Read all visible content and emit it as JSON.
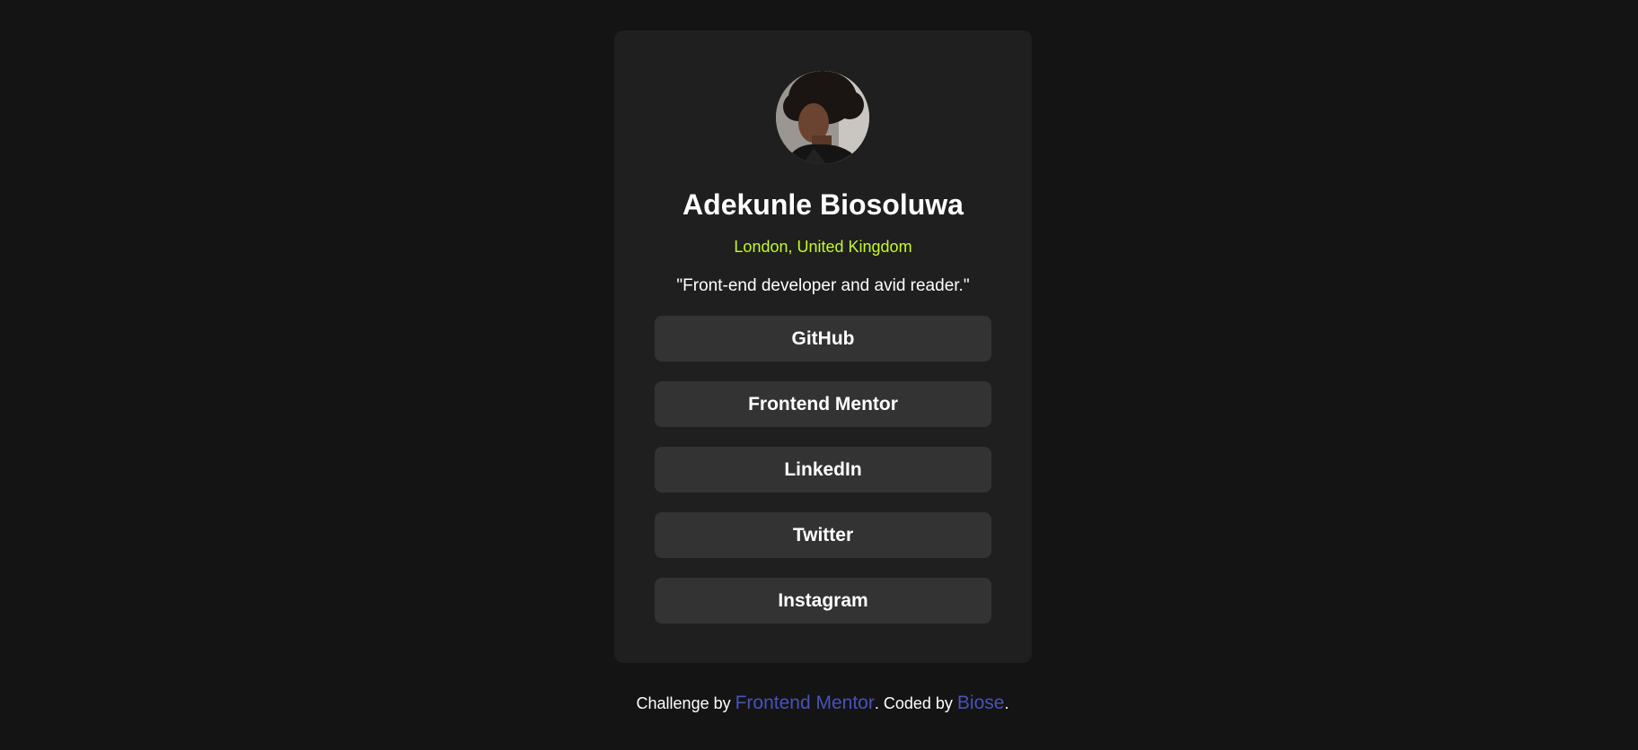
{
  "profile": {
    "avatar_icon": "profile-photo",
    "name": "Adekunle Biosoluwa",
    "location": "London, United Kingdom",
    "bio": "\"Front-end developer and avid reader.\""
  },
  "links": [
    {
      "label": "GitHub"
    },
    {
      "label": "Frontend Mentor"
    },
    {
      "label": "LinkedIn"
    },
    {
      "label": "Twitter"
    },
    {
      "label": "Instagram"
    }
  ],
  "footer": {
    "prefix": "Challenge by ",
    "challenge_link": "Frontend Mentor",
    "middle": ". Coded by ",
    "author_link": "Biose",
    "suffix": "."
  },
  "colors": {
    "background": "#141414",
    "card": "#1f1f1f",
    "button": "#333333",
    "accent_green": "#c4f82a",
    "link_blue": "#4a52b8"
  }
}
